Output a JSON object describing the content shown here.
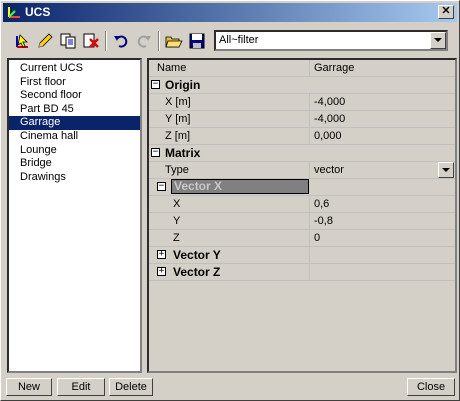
{
  "window": {
    "title": "UCS"
  },
  "toolbar": {
    "buttons": [
      "select-icon",
      "edit-pencil-icon",
      "copy-icon",
      "delete-icon",
      "undo-icon",
      "redo-icon",
      "open-folder-icon",
      "save-disk-icon"
    ],
    "filter": {
      "value": "All~filter"
    }
  },
  "list": {
    "items": [
      "Current UCS",
      "First floor",
      "Second floor",
      "Part BD 45",
      "Garrage",
      "Cinema hall",
      "Lounge",
      "Bridge",
      "Drawings"
    ],
    "selected": "Garrage"
  },
  "grid": {
    "header": {
      "name": "Name",
      "value": "Garrage"
    },
    "origin": {
      "label": "Origin",
      "x_label": "X [m]",
      "x": "-4,000",
      "y_label": "Y [m]",
      "y": "-4,000",
      "z_label": "Z [m]",
      "z": "0,000"
    },
    "matrix": {
      "label": "Matrix",
      "type_label": "Type",
      "type": "vector"
    },
    "vector_x": {
      "label": "Vector X",
      "x_label": "X",
      "x": "0,6",
      "y_label": "Y",
      "y": "-0,8",
      "z_label": "Z",
      "z": "0"
    },
    "vector_y": {
      "label": "Vector Y"
    },
    "vector_z": {
      "label": "Vector Z"
    }
  },
  "buttons": {
    "new": "New",
    "edit": "Edit",
    "delete": "Delete",
    "close": "Close"
  }
}
